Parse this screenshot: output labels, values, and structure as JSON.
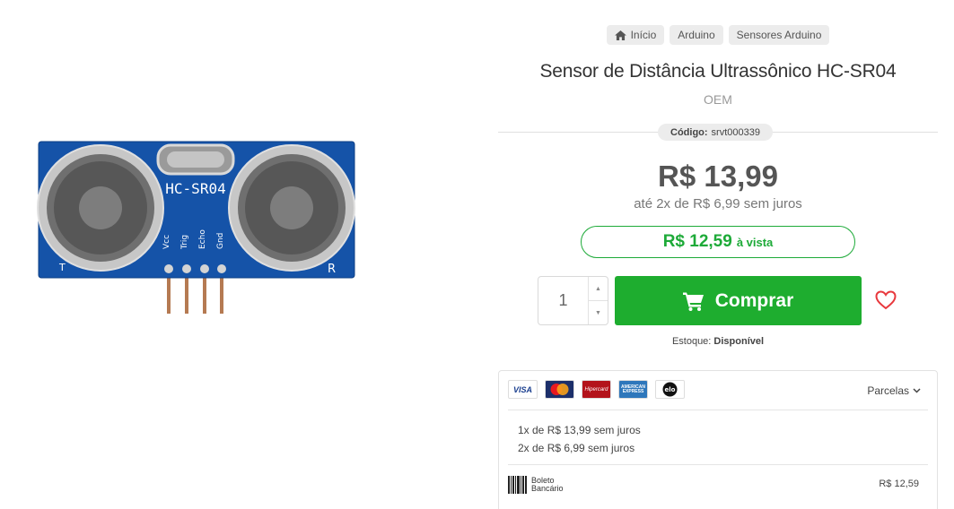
{
  "image": {
    "alt": "Sensor HC-SR04",
    "chip_label": "HC-SR04",
    "pin_labels": [
      "Vcc",
      "Trig",
      "Echo",
      "Gnd"
    ],
    "corner_left": "T",
    "corner_right": "R"
  },
  "breadcrumb": [
    {
      "label": "Início",
      "icon": "home-icon"
    },
    {
      "label": "Arduino"
    },
    {
      "label": "Sensores Arduino"
    }
  ],
  "product": {
    "title": "Sensor de Distância Ultrassônico HC-SR04",
    "brand": "OEM",
    "code_label": "Código:",
    "code_value": "srvt000339",
    "price": "R$ 13,99",
    "installment_text": "até 2x de R$ 6,99 sem juros",
    "cash_price": "R$ 12,59",
    "cash_label": "à vista"
  },
  "purchase": {
    "quantity": "1",
    "buy_label": "Comprar",
    "stock_label": "Estoque:",
    "stock_value": "Disponível"
  },
  "payment": {
    "cards": [
      {
        "name": "visa-card-icon",
        "text": "VISA"
      },
      {
        "name": "mastercard-card-icon",
        "text": ""
      },
      {
        "name": "hipercard-card-icon",
        "text": "Hipercard"
      },
      {
        "name": "amex-card-icon",
        "text": "AMERICAN EXPRESS"
      },
      {
        "name": "elo-card-icon",
        "text": "elo"
      }
    ],
    "dropdown_label": "Parcelas",
    "installments": [
      "1x de R$ 13,99 sem juros",
      "2x de R$ 6,99 sem juros"
    ],
    "boleto_line1": "Boleto",
    "boleto_line2": "Bancário",
    "boleto_price": "R$ 12,59"
  },
  "colors": {
    "accent_green": "#1ead2f",
    "wish_red": "#e8383d",
    "board_blue": "#1553a8"
  }
}
